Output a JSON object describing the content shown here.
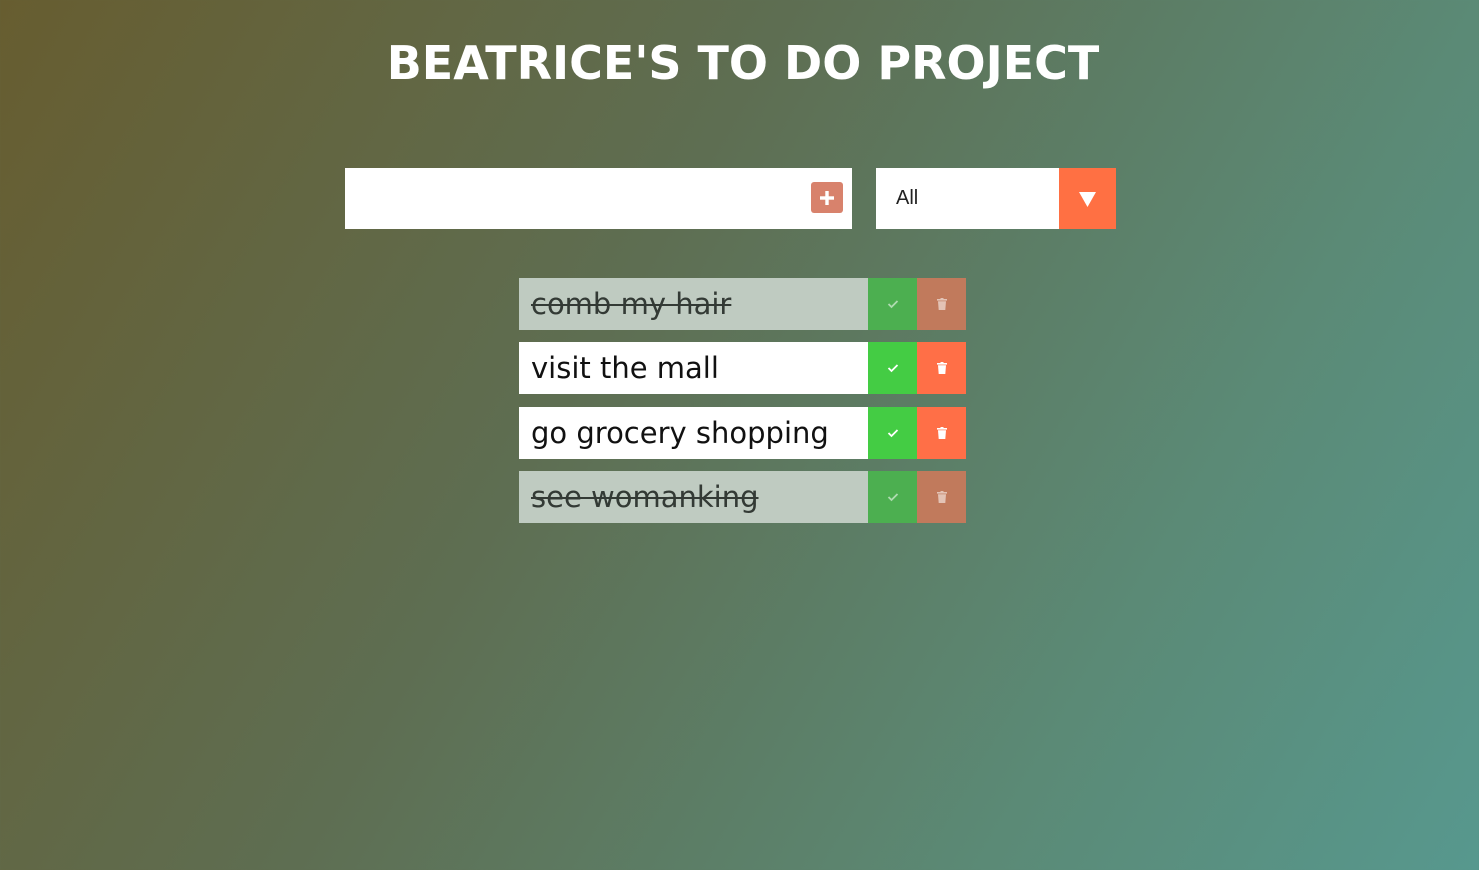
{
  "header": {
    "title": "BEATRICE'S TO DO PROJECT"
  },
  "form": {
    "input_value": "",
    "add_icon": "plus-icon",
    "filter_selected": "All",
    "filter_icon": "caret-down-icon",
    "accent_color": "#ff7043"
  },
  "todos": [
    {
      "text": "comb my hair",
      "completed": true
    },
    {
      "text": "visit the mall",
      "completed": false
    },
    {
      "text": "go grocery shopping",
      "completed": false
    },
    {
      "text": "see womanking",
      "completed": true
    }
  ],
  "colors": {
    "check": "#44cc44",
    "trash": "#ff6f47",
    "completed_row": "#bfcbc1"
  }
}
